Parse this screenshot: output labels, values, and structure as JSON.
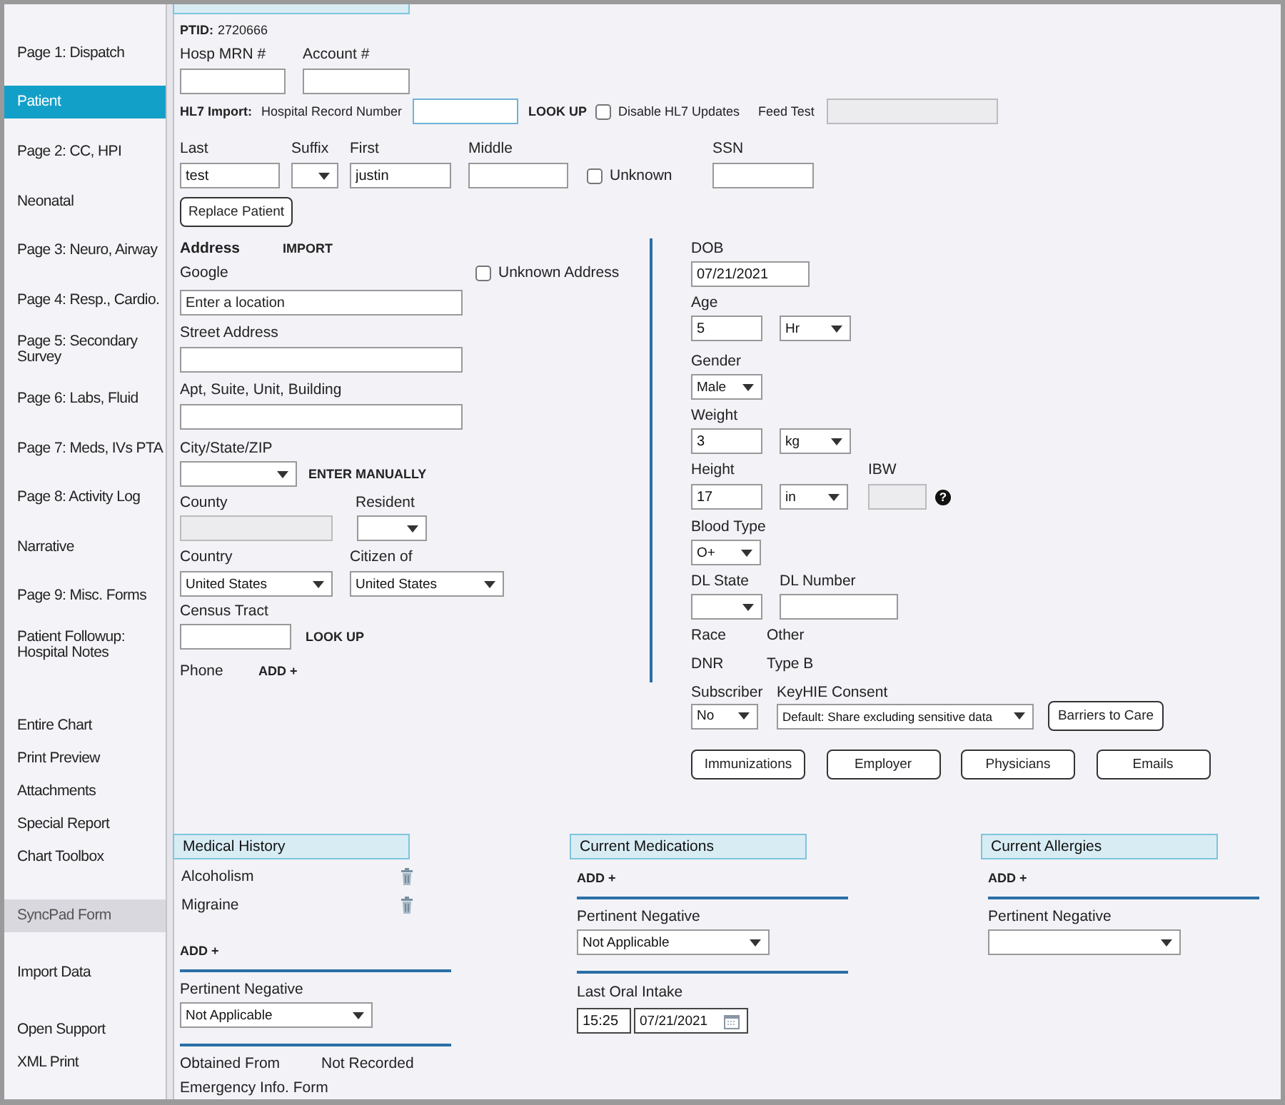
{
  "sidebar": {
    "groups": [
      [
        {
          "label": "Page 1: Dispatch",
          "selected": false,
          "disabled": false
        },
        {
          "label": "Patient",
          "selected": true,
          "disabled": false
        },
        {
          "label": "Page 2: CC, HPI",
          "selected": false,
          "disabled": false
        },
        {
          "label": "Neonatal",
          "selected": false,
          "disabled": false
        },
        {
          "label": "Page 3: Neuro, Airway",
          "selected": false,
          "disabled": false
        },
        {
          "label": "Page 4: Resp., Cardio.",
          "selected": false,
          "disabled": false
        },
        {
          "label": "Page 5: Secondary Survey",
          "selected": false,
          "disabled": false
        },
        {
          "label": "Page 6: Labs, Fluid",
          "selected": false,
          "disabled": false
        },
        {
          "label": "Page 7: Meds, IVs PTA",
          "selected": false,
          "disabled": false
        },
        {
          "label": "Page 8: Activity Log",
          "selected": false,
          "disabled": false
        },
        {
          "label": "Narrative",
          "selected": false,
          "disabled": false
        },
        {
          "label": "Page 9: Misc. Forms",
          "selected": false,
          "disabled": false
        },
        {
          "label": "Patient Followup: Hospital Notes",
          "selected": false,
          "disabled": false
        }
      ],
      [
        {
          "label": "Entire Chart",
          "selected": false,
          "disabled": false
        },
        {
          "label": "Print Preview",
          "selected": false,
          "disabled": false
        },
        {
          "label": "Attachments",
          "selected": false,
          "disabled": false
        },
        {
          "label": "Special Report",
          "selected": false,
          "disabled": false
        },
        {
          "label": "Chart Toolbox",
          "selected": false,
          "disabled": false
        }
      ],
      [
        {
          "label": "SyncPad Form",
          "selected": false,
          "disabled": true
        }
      ],
      [
        {
          "label": "Import Data",
          "selected": false,
          "disabled": false
        }
      ],
      [
        {
          "label": "Open Support",
          "selected": false,
          "disabled": false
        },
        {
          "label": "XML Print",
          "selected": false,
          "disabled": false
        }
      ]
    ]
  },
  "header": {
    "ptid_label": "PTID:",
    "ptid": "2720666",
    "hosp_mrn": {
      "label": "Hosp MRN #"
    },
    "account": {
      "label": "Account #"
    },
    "hl7": {
      "label": "HL7 Import:",
      "record_label": "Hospital Record Number",
      "lookup": "LOOK UP",
      "disable_updates": {
        "label": "Disable HL7 Updates",
        "checked": false
      },
      "feed_test": {
        "label": "Feed Test",
        "disabled": true
      }
    },
    "last": {
      "label": "Last",
      "value": "test"
    },
    "suffix": {
      "label": "Suffix"
    },
    "first": {
      "label": "First",
      "value": "justin"
    },
    "middle": {
      "label": "Middle"
    },
    "unknown": {
      "label": "Unknown",
      "checked": false
    },
    "ssn": {
      "label": "SSN"
    },
    "replace_button": "Replace Patient"
  },
  "address": {
    "title": "Address",
    "import": "IMPORT",
    "unknown": {
      "label": "Unknown Address",
      "checked": false
    },
    "google": {
      "label": "Google",
      "placeholder": "Enter a location"
    },
    "street": {
      "label": "Street Address"
    },
    "apt": {
      "label": "Apt, Suite, Unit, Building"
    },
    "city": {
      "label": "City/State/ZIP",
      "action": "ENTER MANUALLY"
    },
    "county": {
      "label": "County",
      "disabled": true
    },
    "resident": {
      "label": "Resident"
    },
    "country": {
      "label": "Country",
      "value": "United States"
    },
    "citizen": {
      "label": "Citizen of",
      "value": "United States"
    },
    "census": {
      "label": "Census Tract",
      "action": "LOOK UP"
    },
    "phone": {
      "label": "Phone",
      "action": "ADD +"
    }
  },
  "demographics": {
    "dob": {
      "label": "DOB",
      "value": "07/21/2021"
    },
    "age": {
      "label": "Age",
      "value": "5",
      "unit": "Hr"
    },
    "gender": {
      "label": "Gender",
      "value": "Male"
    },
    "weight": {
      "label": "Weight",
      "value": "3",
      "unit": "kg"
    },
    "height": {
      "label": "Height",
      "value": "17",
      "unit": "in"
    },
    "ibw": {
      "label": "IBW",
      "disabled": true,
      "help": "?"
    },
    "blood_type": {
      "label": "Blood Type",
      "value": "O+"
    },
    "dl_state": {
      "label": "DL State"
    },
    "dl_number": {
      "label": "DL Number"
    },
    "race": {
      "label": "Race",
      "value": "Other"
    },
    "dnr": {
      "label": "DNR",
      "value": "Type B"
    },
    "subscriber": {
      "label": "Subscriber",
      "value": "No"
    },
    "consent": {
      "label": "KeyHIE Consent",
      "value": "Default: Share excluding sensitive data"
    },
    "barriers_button": "Barriers to Care",
    "buttons": [
      "Immunizations",
      "Employer",
      "Physicians",
      "Emails"
    ]
  },
  "sections": [
    {
      "title": "Medical History",
      "items": [
        {
          "label": "Alcoholism"
        },
        {
          "label": "Migraine"
        }
      ],
      "add": "ADD +",
      "pertinent_negative": {
        "label": "Pertinent Negative",
        "value": "Not Applicable"
      },
      "obtained_from": {
        "label": "Obtained From",
        "value": "Not Recorded"
      },
      "footer": "Emergency Info. Form"
    },
    {
      "title": "Current Medications",
      "add": "ADD +",
      "pertinent_negative": {
        "label": "Pertinent Negative",
        "value": "Not Applicable"
      },
      "last_oral_intake": {
        "label": "Last Oral Intake",
        "time": "15:25",
        "date": "07/21/2021"
      }
    },
    {
      "title": "Current Allergies",
      "add": "ADD +",
      "pertinent_negative": {
        "label": "Pertinent Negative"
      }
    }
  ]
}
